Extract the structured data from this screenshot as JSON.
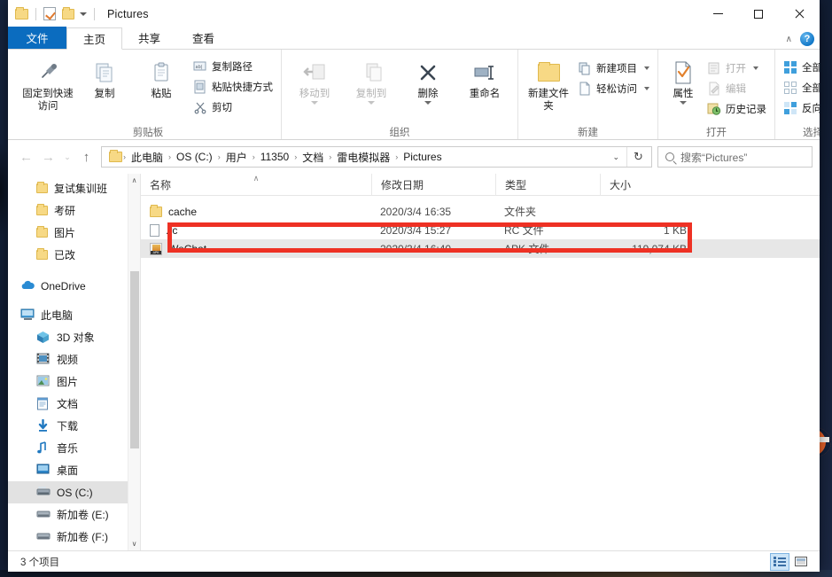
{
  "window": {
    "title": "Pictures",
    "controls": {
      "minimize": "—",
      "maximize": "□",
      "close": "✕"
    }
  },
  "quick_access": {
    "tooltip_props": "properties",
    "caret": "▾"
  },
  "tabs": [
    {
      "label": "文件",
      "id": "file",
      "type": "file-menu"
    },
    {
      "label": "主页",
      "id": "home",
      "active": true
    },
    {
      "label": "共享",
      "id": "share",
      "active": false
    },
    {
      "label": "查看",
      "id": "view",
      "active": false
    }
  ],
  "ribbon": {
    "collapse_caret": "∧",
    "help": "?",
    "groups": [
      {
        "label": "剪贴板",
        "big": [
          {
            "label": "固定到快速访问",
            "icon": "pin-icon",
            "dim": false
          },
          {
            "label": "复制",
            "icon": "copy-icon",
            "dim": false
          },
          {
            "label": "粘贴",
            "icon": "paste-icon",
            "dim": false
          }
        ],
        "small": [
          {
            "label": "复制路径",
            "icon": "copy-path-icon",
            "dim": false
          },
          {
            "label": "粘贴快捷方式",
            "icon": "paste-shortcut-icon",
            "dim": false
          },
          {
            "label": "剪切",
            "icon": "scissors-icon",
            "dim": false
          }
        ]
      },
      {
        "label": "组织",
        "big": [
          {
            "label": "移动到",
            "icon": "move-to-icon",
            "dim": true,
            "caret": true
          },
          {
            "label": "复制到",
            "icon": "copy-to-icon",
            "dim": true,
            "caret": true
          },
          {
            "label": "删除",
            "icon": "delete-icon",
            "dim": false,
            "caret": true
          },
          {
            "label": "重命名",
            "icon": "rename-icon",
            "dim": false
          }
        ],
        "small": []
      },
      {
        "label": "新建",
        "big": [
          {
            "label": "新建文件夹",
            "icon": "new-folder-icon",
            "dim": false
          }
        ],
        "small": [
          {
            "label": "新建项目",
            "icon": "new-item-icon",
            "dim": false,
            "caret": true
          },
          {
            "label": "轻松访问",
            "icon": "easy-access-icon",
            "dim": false,
            "caret": true
          }
        ]
      },
      {
        "label": "打开",
        "big": [
          {
            "label": "属性",
            "icon": "properties-icon",
            "dim": false,
            "caret": true
          }
        ],
        "small": [
          {
            "label": "打开",
            "icon": "open-icon",
            "dim": true,
            "caret": true
          },
          {
            "label": "编辑",
            "icon": "edit-icon",
            "dim": true
          },
          {
            "label": "历史记录",
            "icon": "history-icon",
            "dim": false
          }
        ]
      },
      {
        "label": "选择",
        "big": [],
        "small": [
          {
            "label": "全部选择",
            "icon": "select-all-icon",
            "dim": false
          },
          {
            "label": "全部取消",
            "icon": "select-none-icon",
            "dim": false
          },
          {
            "label": "反向选择",
            "icon": "invert-selection-icon",
            "dim": false
          }
        ]
      }
    ]
  },
  "addressbar": {
    "back": "←",
    "forward": "→",
    "recent": "⌄",
    "up": "↑",
    "breadcrumbs": [
      "此电脑",
      "OS (C:)",
      "用户",
      "11350",
      "文档",
      "雷电模拟器",
      "Pictures"
    ],
    "separator": "›",
    "dropdown_caret": "⌄",
    "refresh": "↻"
  },
  "search": {
    "placeholder": "搜索“Pictures”"
  },
  "navpane": {
    "items": [
      {
        "label": "复试集训班",
        "icon": "folder-icon",
        "indent": 1
      },
      {
        "label": "考研",
        "icon": "folder-icon",
        "indent": 1
      },
      {
        "label": "图片",
        "icon": "folder-icon",
        "indent": 1
      },
      {
        "label": "已改",
        "icon": "folder-icon",
        "indent": 1
      },
      {
        "label": "OneDrive",
        "icon": "onedrive-icon",
        "indent": 0
      },
      {
        "label": "此电脑",
        "icon": "this-pc-icon",
        "indent": 0
      },
      {
        "label": "3D 对象",
        "icon": "3d-objects-icon",
        "indent": 1
      },
      {
        "label": "视频",
        "icon": "videos-icon",
        "indent": 1
      },
      {
        "label": "图片",
        "icon": "pictures-icon",
        "indent": 1
      },
      {
        "label": "文档",
        "icon": "documents-icon",
        "indent": 1
      },
      {
        "label": "下载",
        "icon": "downloads-icon",
        "indent": 1
      },
      {
        "label": "音乐",
        "icon": "music-icon",
        "indent": 1
      },
      {
        "label": "桌面",
        "icon": "desktop-icon",
        "indent": 1
      },
      {
        "label": "OS (C:)",
        "icon": "drive-icon",
        "indent": 1,
        "selected": true
      },
      {
        "label": "新加卷 (E:)",
        "icon": "drive-icon",
        "indent": 1
      },
      {
        "label": "新加卷 (F:)",
        "icon": "drive-icon",
        "indent": 1
      }
    ],
    "scroll_up": "∧",
    "scroll_down": "∨"
  },
  "filelist": {
    "columns": [
      {
        "key": "name",
        "label": "名称",
        "sorted": true,
        "sort_mark": "∧"
      },
      {
        "key": "date",
        "label": "修改日期"
      },
      {
        "key": "type",
        "label": "类型"
      },
      {
        "key": "size",
        "label": "大小"
      }
    ],
    "rows": [
      {
        "name": "cache",
        "date": "2020/3/4 16:35",
        "type": "文件夹",
        "size": "",
        "icon": "folder-icon",
        "selected": false,
        "highlighted": false
      },
      {
        "name": ".rc",
        "date": "2020/3/4 15:27",
        "type": "RC 文件",
        "size": "1 KB",
        "icon": "file-icon",
        "selected": false,
        "highlighted": false
      },
      {
        "name": "WeChat",
        "date": "2020/3/4 16:40",
        "type": "APK 文件",
        "size": "119,074 KB",
        "icon": "apk-icon",
        "selected": true,
        "highlighted": true
      }
    ]
  },
  "annotation": {
    "color": "#ee3124",
    "target_row": "WeChat"
  },
  "statusbar": {
    "item_count": "3 个项目",
    "views": [
      {
        "name": "details-view-button",
        "active": true
      },
      {
        "name": "large-icons-view-button",
        "active": false
      }
    ]
  },
  "colors": {
    "accent": "#0b6cbf",
    "selection": "#e7e7e7",
    "annotation": "#ee3124",
    "folder": "#f7d985"
  }
}
